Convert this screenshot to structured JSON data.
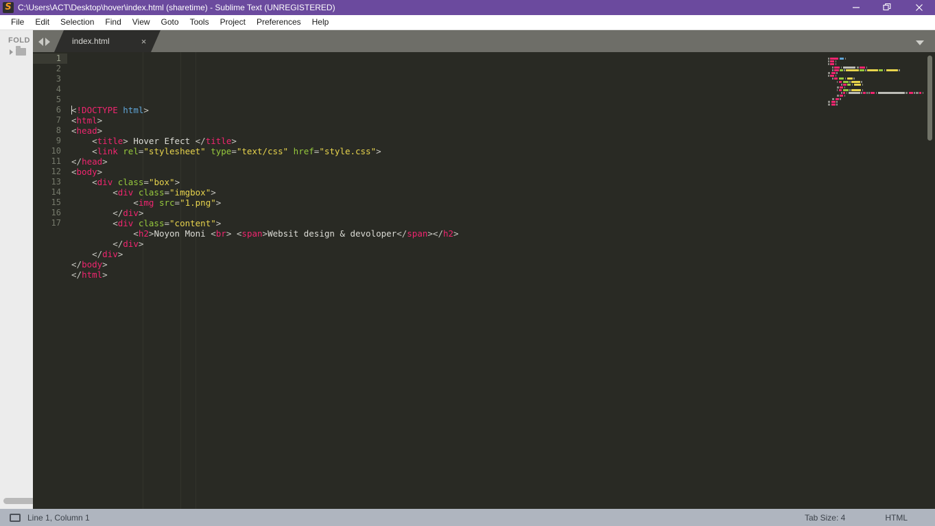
{
  "titlebar": {
    "title": "C:\\Users\\ACT\\Desktop\\hover\\index.html (sharetime) - Sublime Text (UNREGISTERED)",
    "logo_letter": "S",
    "logo_icon": "sublime-text-logo-icon",
    "minimize_icon": "minimize-icon",
    "restore_icon": "restore-icon",
    "close_icon": "close-icon",
    "bg_color": "#6B4A9E"
  },
  "menubar": {
    "items": [
      {
        "label": "File"
      },
      {
        "label": "Edit"
      },
      {
        "label": "Selection"
      },
      {
        "label": "Find"
      },
      {
        "label": "View"
      },
      {
        "label": "Goto"
      },
      {
        "label": "Tools"
      },
      {
        "label": "Project"
      },
      {
        "label": "Preferences"
      },
      {
        "label": "Help"
      }
    ]
  },
  "sidebar": {
    "header": "FOLD",
    "expand_icon": "chevron-right-icon",
    "folder_icon": "folder-icon",
    "scrollbar_icon": "horizontal-scrollbar"
  },
  "tabbar": {
    "nav_back_icon": "nav-back-arrow-icon",
    "nav_forward_icon": "nav-forward-arrow-icon",
    "tabs": [
      {
        "label": "index.html",
        "close_icon": "close-icon",
        "close_glyph": "×",
        "active": true
      }
    ],
    "overflow_icon": "chevron-down-icon"
  },
  "editor": {
    "active_line": 1,
    "line_numbers": [
      1,
      2,
      3,
      4,
      5,
      6,
      7,
      8,
      9,
      10,
      11,
      12,
      13,
      14,
      15,
      16,
      17
    ],
    "lines": [
      {
        "n": 1,
        "tokens": [
          {
            "t": "<",
            "c": "p"
          },
          {
            "t": "!DOCTYPE",
            "c": "dt"
          },
          {
            "t": " html",
            "c": "bl"
          },
          {
            "t": ">",
            "c": "p"
          }
        ]
      },
      {
        "n": 2,
        "tokens": [
          {
            "t": "<",
            "c": "p"
          },
          {
            "t": "html",
            "c": "tg"
          },
          {
            "t": ">",
            "c": "p"
          }
        ]
      },
      {
        "n": 3,
        "tokens": [
          {
            "t": "<",
            "c": "p"
          },
          {
            "t": "head",
            "c": "tg"
          },
          {
            "t": ">",
            "c": "p"
          }
        ]
      },
      {
        "n": 4,
        "tokens": [
          {
            "t": "    <",
            "c": "p"
          },
          {
            "t": "title",
            "c": "tg"
          },
          {
            "t": ">",
            "c": "p"
          },
          {
            "t": " Hover Efect ",
            "c": "tx"
          },
          {
            "t": "</",
            "c": "p"
          },
          {
            "t": "title",
            "c": "tg"
          },
          {
            "t": ">",
            "c": "p"
          }
        ]
      },
      {
        "n": 5,
        "tokens": [
          {
            "t": "    <",
            "c": "p"
          },
          {
            "t": "link",
            "c": "tg"
          },
          {
            "t": " ",
            "c": "tx"
          },
          {
            "t": "rel",
            "c": "at"
          },
          {
            "t": "=",
            "c": "p"
          },
          {
            "t": "\"stylesheet\"",
            "c": "st"
          },
          {
            "t": " ",
            "c": "tx"
          },
          {
            "t": "type",
            "c": "at"
          },
          {
            "t": "=",
            "c": "p"
          },
          {
            "t": "\"text/css\"",
            "c": "st"
          },
          {
            "t": " ",
            "c": "tx"
          },
          {
            "t": "href",
            "c": "at"
          },
          {
            "t": "=",
            "c": "p"
          },
          {
            "t": "\"style.css\"",
            "c": "st"
          },
          {
            "t": ">",
            "c": "p"
          }
        ]
      },
      {
        "n": 6,
        "tokens": [
          {
            "t": "</",
            "c": "p"
          },
          {
            "t": "head",
            "c": "tg"
          },
          {
            "t": ">",
            "c": "p"
          }
        ]
      },
      {
        "n": 7,
        "tokens": [
          {
            "t": "<",
            "c": "p"
          },
          {
            "t": "body",
            "c": "tg"
          },
          {
            "t": ">",
            "c": "p"
          }
        ]
      },
      {
        "n": 8,
        "tokens": [
          {
            "t": "    <",
            "c": "p"
          },
          {
            "t": "div",
            "c": "tg"
          },
          {
            "t": " ",
            "c": "tx"
          },
          {
            "t": "class",
            "c": "at"
          },
          {
            "t": "=",
            "c": "p"
          },
          {
            "t": "\"box\"",
            "c": "st"
          },
          {
            "t": ">",
            "c": "p"
          }
        ]
      },
      {
        "n": 9,
        "tokens": [
          {
            "t": "        <",
            "c": "p"
          },
          {
            "t": "div",
            "c": "tg"
          },
          {
            "t": " ",
            "c": "tx"
          },
          {
            "t": "class",
            "c": "at"
          },
          {
            "t": "=",
            "c": "p"
          },
          {
            "t": "\"imgbox\"",
            "c": "st"
          },
          {
            "t": ">",
            "c": "p"
          }
        ]
      },
      {
        "n": 10,
        "tokens": [
          {
            "t": "            <",
            "c": "p"
          },
          {
            "t": "img",
            "c": "tg"
          },
          {
            "t": " ",
            "c": "tx"
          },
          {
            "t": "src",
            "c": "at"
          },
          {
            "t": "=",
            "c": "p"
          },
          {
            "t": "\"1.png\"",
            "c": "st"
          },
          {
            "t": ">",
            "c": "p"
          }
        ]
      },
      {
        "n": 11,
        "tokens": [
          {
            "t": "        </",
            "c": "p"
          },
          {
            "t": "div",
            "c": "tg"
          },
          {
            "t": ">",
            "c": "p"
          }
        ]
      },
      {
        "n": 12,
        "tokens": [
          {
            "t": "        <",
            "c": "p"
          },
          {
            "t": "div",
            "c": "tg"
          },
          {
            "t": " ",
            "c": "tx"
          },
          {
            "t": "class",
            "c": "at"
          },
          {
            "t": "=",
            "c": "p"
          },
          {
            "t": "\"content\"",
            "c": "st"
          },
          {
            "t": ">",
            "c": "p"
          }
        ]
      },
      {
        "n": 13,
        "tokens": [
          {
            "t": "            <",
            "c": "p"
          },
          {
            "t": "h2",
            "c": "tg"
          },
          {
            "t": ">",
            "c": "p"
          },
          {
            "t": "Noyon Moni ",
            "c": "tx"
          },
          {
            "t": "<",
            "c": "p"
          },
          {
            "t": "br",
            "c": "tg"
          },
          {
            "t": ">",
            "c": "p"
          },
          {
            "t": " ",
            "c": "tx"
          },
          {
            "t": "<",
            "c": "p"
          },
          {
            "t": "span",
            "c": "tg"
          },
          {
            "t": ">",
            "c": "p"
          },
          {
            "t": "Websit design & devoloper",
            "c": "tx"
          },
          {
            "t": "</",
            "c": "p"
          },
          {
            "t": "span",
            "c": "tg"
          },
          {
            "t": ">",
            "c": "p"
          },
          {
            "t": "</",
            "c": "p"
          },
          {
            "t": "h2",
            "c": "tg"
          },
          {
            "t": ">",
            "c": "p"
          }
        ]
      },
      {
        "n": 14,
        "tokens": [
          {
            "t": "        </",
            "c": "p"
          },
          {
            "t": "div",
            "c": "tg"
          },
          {
            "t": ">",
            "c": "p"
          }
        ]
      },
      {
        "n": 15,
        "tokens": [
          {
            "t": "    </",
            "c": "p"
          },
          {
            "t": "div",
            "c": "tg"
          },
          {
            "t": ">",
            "c": "p"
          }
        ]
      },
      {
        "n": 16,
        "tokens": [
          {
            "t": "</",
            "c": "p"
          },
          {
            "t": "body",
            "c": "tg"
          },
          {
            "t": ">",
            "c": "p"
          }
        ]
      },
      {
        "n": 17,
        "tokens": [
          {
            "t": "</",
            "c": "p"
          },
          {
            "t": "html",
            "c": "tg"
          },
          {
            "t": ">",
            "c": "p"
          }
        ]
      }
    ]
  },
  "minimap": {
    "scrollbar_icon": "minimap-scrollbar"
  },
  "statusbar": {
    "monitor_icon": "monitor-icon",
    "cursor_position": "Line 1, Column 1",
    "tab_size": "Tab Size: 4",
    "syntax": "HTML"
  }
}
